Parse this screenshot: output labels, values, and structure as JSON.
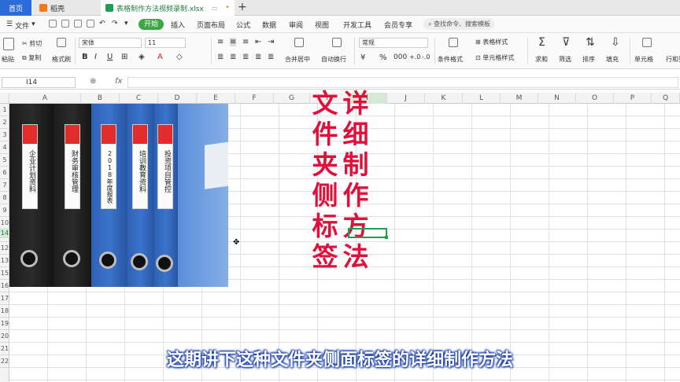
{
  "tabs": {
    "home": "首页",
    "doc": "稻壳",
    "file": "表格制作方法视频录制.xlsx",
    "plus": "+"
  },
  "menu": {
    "file": "文件",
    "start": "开始",
    "items": [
      "插入",
      "页面布局",
      "公式",
      "数据",
      "审阅",
      "视图",
      "开发工具",
      "会员专享"
    ],
    "search": "查找命令、搜索模板"
  },
  "ribbon": {
    "cut": "剪切",
    "paste": "粘贴",
    "copy": "复制",
    "format_painter": "格式刷",
    "font_name": "宋体",
    "font_size": "11",
    "merge": "合并居中",
    "wrap": "自动换行",
    "number_format": "常规",
    "cond_format": "条件格式",
    "table_style": "表格样式",
    "cell_style": "单元格样式",
    "sum": "求和",
    "filter": "筛选",
    "sort": "排序",
    "fill": "填充",
    "cell": "单元格",
    "row_col": "行和列"
  },
  "formula_bar": {
    "name_box": "I14",
    "fx": "fx"
  },
  "columns": [
    "A",
    "B",
    "C",
    "D",
    "E",
    "F",
    "G",
    "H",
    "I",
    "J",
    "K",
    "L",
    "M",
    "N",
    "O",
    "P",
    "Q"
  ],
  "rows": [
    "1",
    "2",
    "3",
    "4",
    "5",
    "6",
    "7",
    "8",
    "9",
    "10",
    "11",
    "12",
    "13",
    "14",
    "15",
    "16",
    "17",
    "18",
    "19",
    "20",
    "21",
    "22"
  ],
  "active_cell": {
    "column": "I",
    "row": "14"
  },
  "binders": [
    {
      "label": "企业计划资料",
      "color": "black"
    },
    {
      "label": "财务审核管理",
      "color": "black"
    },
    {
      "label": "2018年度报表",
      "color": "blue"
    },
    {
      "label": "培训教育资料",
      "color": "blue"
    },
    {
      "label": "投资项目管控",
      "color": "blue"
    }
  ],
  "red_text": {
    "col1": [
      "文",
      "件",
      "夹",
      "侧",
      "标",
      "签"
    ],
    "col2": [
      "详",
      "细",
      "制",
      "作",
      "方",
      "法"
    ]
  },
  "subtitle": "这期讲下这种文件夹侧面标签的详细制作方法",
  "colors": {
    "accent": "#1f9d55",
    "title_red": "#e0103a",
    "binder_blue": "#3b73cc"
  }
}
